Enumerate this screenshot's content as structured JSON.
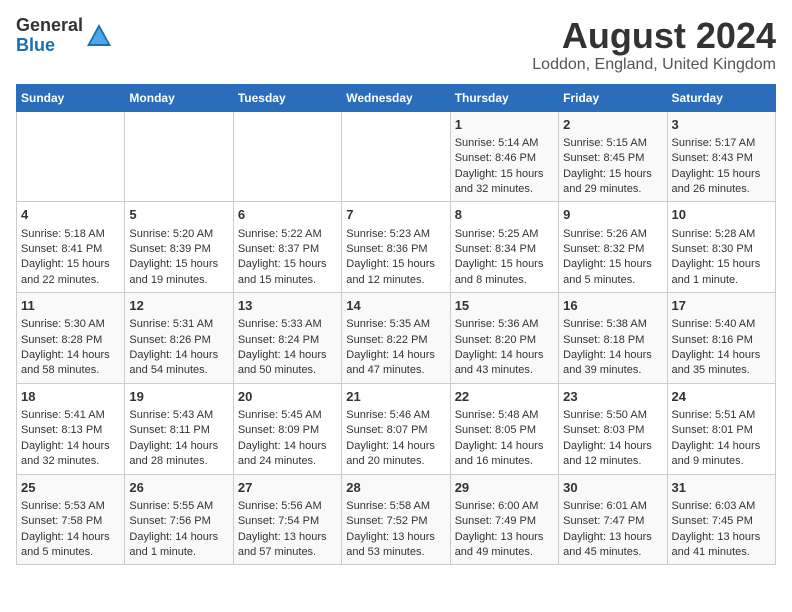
{
  "header": {
    "logo_general": "General",
    "logo_blue": "Blue",
    "month_title": "August 2024",
    "location": "Loddon, England, United Kingdom"
  },
  "weekdays": [
    "Sunday",
    "Monday",
    "Tuesday",
    "Wednesday",
    "Thursday",
    "Friday",
    "Saturday"
  ],
  "weeks": [
    [
      {
        "day": "",
        "info": ""
      },
      {
        "day": "",
        "info": ""
      },
      {
        "day": "",
        "info": ""
      },
      {
        "day": "",
        "info": ""
      },
      {
        "day": "1",
        "info": "Sunrise: 5:14 AM\nSunset: 8:46 PM\nDaylight: 15 hours\nand 32 minutes."
      },
      {
        "day": "2",
        "info": "Sunrise: 5:15 AM\nSunset: 8:45 PM\nDaylight: 15 hours\nand 29 minutes."
      },
      {
        "day": "3",
        "info": "Sunrise: 5:17 AM\nSunset: 8:43 PM\nDaylight: 15 hours\nand 26 minutes."
      }
    ],
    [
      {
        "day": "4",
        "info": "Sunrise: 5:18 AM\nSunset: 8:41 PM\nDaylight: 15 hours\nand 22 minutes."
      },
      {
        "day": "5",
        "info": "Sunrise: 5:20 AM\nSunset: 8:39 PM\nDaylight: 15 hours\nand 19 minutes."
      },
      {
        "day": "6",
        "info": "Sunrise: 5:22 AM\nSunset: 8:37 PM\nDaylight: 15 hours\nand 15 minutes."
      },
      {
        "day": "7",
        "info": "Sunrise: 5:23 AM\nSunset: 8:36 PM\nDaylight: 15 hours\nand 12 minutes."
      },
      {
        "day": "8",
        "info": "Sunrise: 5:25 AM\nSunset: 8:34 PM\nDaylight: 15 hours\nand 8 minutes."
      },
      {
        "day": "9",
        "info": "Sunrise: 5:26 AM\nSunset: 8:32 PM\nDaylight: 15 hours\nand 5 minutes."
      },
      {
        "day": "10",
        "info": "Sunrise: 5:28 AM\nSunset: 8:30 PM\nDaylight: 15 hours\nand 1 minute."
      }
    ],
    [
      {
        "day": "11",
        "info": "Sunrise: 5:30 AM\nSunset: 8:28 PM\nDaylight: 14 hours\nand 58 minutes."
      },
      {
        "day": "12",
        "info": "Sunrise: 5:31 AM\nSunset: 8:26 PM\nDaylight: 14 hours\nand 54 minutes."
      },
      {
        "day": "13",
        "info": "Sunrise: 5:33 AM\nSunset: 8:24 PM\nDaylight: 14 hours\nand 50 minutes."
      },
      {
        "day": "14",
        "info": "Sunrise: 5:35 AM\nSunset: 8:22 PM\nDaylight: 14 hours\nand 47 minutes."
      },
      {
        "day": "15",
        "info": "Sunrise: 5:36 AM\nSunset: 8:20 PM\nDaylight: 14 hours\nand 43 minutes."
      },
      {
        "day": "16",
        "info": "Sunrise: 5:38 AM\nSunset: 8:18 PM\nDaylight: 14 hours\nand 39 minutes."
      },
      {
        "day": "17",
        "info": "Sunrise: 5:40 AM\nSunset: 8:16 PM\nDaylight: 14 hours\nand 35 minutes."
      }
    ],
    [
      {
        "day": "18",
        "info": "Sunrise: 5:41 AM\nSunset: 8:13 PM\nDaylight: 14 hours\nand 32 minutes."
      },
      {
        "day": "19",
        "info": "Sunrise: 5:43 AM\nSunset: 8:11 PM\nDaylight: 14 hours\nand 28 minutes."
      },
      {
        "day": "20",
        "info": "Sunrise: 5:45 AM\nSunset: 8:09 PM\nDaylight: 14 hours\nand 24 minutes."
      },
      {
        "day": "21",
        "info": "Sunrise: 5:46 AM\nSunset: 8:07 PM\nDaylight: 14 hours\nand 20 minutes."
      },
      {
        "day": "22",
        "info": "Sunrise: 5:48 AM\nSunset: 8:05 PM\nDaylight: 14 hours\nand 16 minutes."
      },
      {
        "day": "23",
        "info": "Sunrise: 5:50 AM\nSunset: 8:03 PM\nDaylight: 14 hours\nand 12 minutes."
      },
      {
        "day": "24",
        "info": "Sunrise: 5:51 AM\nSunset: 8:01 PM\nDaylight: 14 hours\nand 9 minutes."
      }
    ],
    [
      {
        "day": "25",
        "info": "Sunrise: 5:53 AM\nSunset: 7:58 PM\nDaylight: 14 hours\nand 5 minutes."
      },
      {
        "day": "26",
        "info": "Sunrise: 5:55 AM\nSunset: 7:56 PM\nDaylight: 14 hours\nand 1 minute."
      },
      {
        "day": "27",
        "info": "Sunrise: 5:56 AM\nSunset: 7:54 PM\nDaylight: 13 hours\nand 57 minutes."
      },
      {
        "day": "28",
        "info": "Sunrise: 5:58 AM\nSunset: 7:52 PM\nDaylight: 13 hours\nand 53 minutes."
      },
      {
        "day": "29",
        "info": "Sunrise: 6:00 AM\nSunset: 7:49 PM\nDaylight: 13 hours\nand 49 minutes."
      },
      {
        "day": "30",
        "info": "Sunrise: 6:01 AM\nSunset: 7:47 PM\nDaylight: 13 hours\nand 45 minutes."
      },
      {
        "day": "31",
        "info": "Sunrise: 6:03 AM\nSunset: 7:45 PM\nDaylight: 13 hours\nand 41 minutes."
      }
    ]
  ]
}
